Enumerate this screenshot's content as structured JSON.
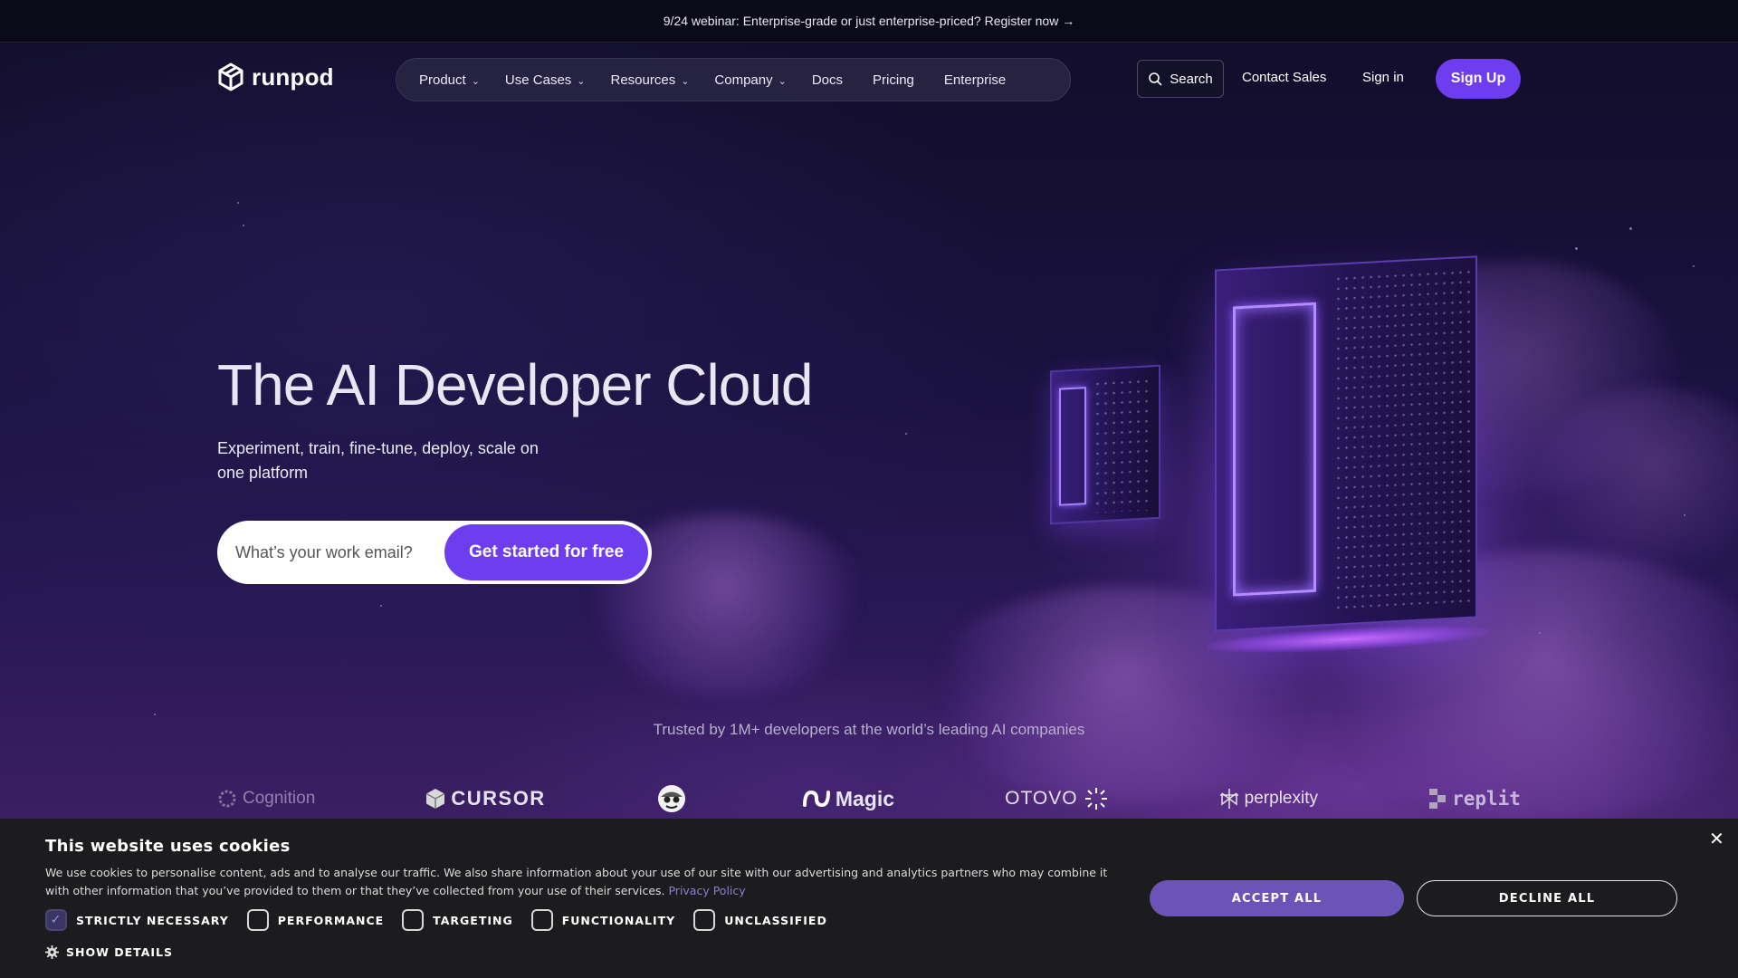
{
  "announcement": {
    "text": "9/24 webinar: Enterprise-grade or just enterprise-priced? Register now →"
  },
  "brand": {
    "name": "runpod",
    "accent": "#6d3ef0"
  },
  "nav": {
    "items": [
      {
        "label": "Product",
        "dropdown": true
      },
      {
        "label": "Use Cases",
        "dropdown": true
      },
      {
        "label": "Resources",
        "dropdown": true
      },
      {
        "label": "Company",
        "dropdown": true
      },
      {
        "label": "Docs",
        "dropdown": false
      },
      {
        "label": "Pricing",
        "dropdown": false
      },
      {
        "label": "Enterprise",
        "dropdown": false
      }
    ],
    "search_label": "Search",
    "contact_sales": "Contact Sales",
    "sign_in": "Sign in",
    "sign_up": "Sign Up"
  },
  "hero": {
    "title": "The AI Developer Cloud",
    "subtitle": "Experiment, train, fine-tune, deploy, scale on one platform",
    "email_placeholder": "What’s your work email?",
    "cta": "Get started for free"
  },
  "trusted": {
    "text": "Trusted by 1M+ developers at the world’s leading AI companies",
    "logos": [
      "Cognition",
      "CURSOR",
      "",
      "Magic",
      "OTOVO",
      "perplexity",
      "replit"
    ]
  },
  "cookie": {
    "title": "This website uses cookies",
    "text": "We use cookies to personalise content, ads and to analyse our traffic. We also share information about your use of our site with our advertising and analytics partners who may combine it with other information that you’ve provided to them or that they’ve collected from your use of their services.",
    "privacy_link": "Privacy Policy",
    "categories": [
      {
        "label": "STRICTLY NECESSARY",
        "checked": true
      },
      {
        "label": "PERFORMANCE",
        "checked": false
      },
      {
        "label": "TARGETING",
        "checked": false
      },
      {
        "label": "FUNCTIONALITY",
        "checked": false
      },
      {
        "label": "UNCLASSIFIED",
        "checked": false
      }
    ],
    "show_details": "SHOW DETAILS",
    "accept_all": "ACCEPT ALL",
    "decline_all": "DECLINE ALL"
  }
}
